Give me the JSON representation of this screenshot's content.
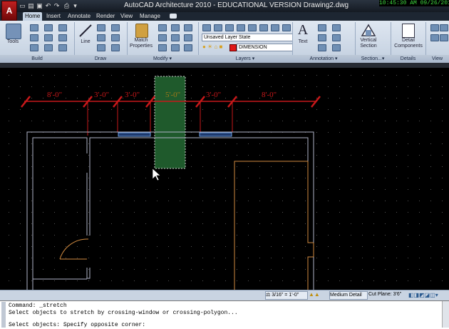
{
  "app": {
    "title": "AutoCAD Architecture 2010 - EDUCATIONAL VERSION    Drawing2.dwg",
    "clock": "10:45:30 AM 09/26/201"
  },
  "tabs": [
    "Home",
    "Insert",
    "Annotate",
    "Render",
    "View",
    "Manage"
  ],
  "ribbon": {
    "tools": "Tools",
    "line": "Line",
    "match": "Match Properties",
    "layer_state": "Unsaved Layer State",
    "layer_name": "DIMENSION",
    "text": "Text",
    "vertical_section": "Vertical Section",
    "detail_components": "Detail Components",
    "view": "View",
    "panels": [
      "Build",
      "Draw",
      "Modify ▾",
      "Layers ▾",
      "Annotation ▾",
      "Section...▾",
      "Details",
      "View"
    ]
  },
  "dimensions": [
    "8'-0\"",
    "3'-0\"",
    "3'-0\"",
    "5'-0\"",
    "3'-0\"",
    "8'-0\""
  ],
  "status": {
    "scale": "3/16\" = 1'-0\"",
    "detail": "Medium Detail",
    "cut_plane_label": "Cut Plane:",
    "cut_plane": "3'6\""
  },
  "command": {
    "line1": "Command: _stretch",
    "line2": "Select objects to stretch by crossing-window or crossing-polygon...",
    "line3": "Select objects: Specify opposite corner:"
  },
  "colors": {
    "dimension": "#c8181a",
    "selection": "#1f5a2c",
    "wall": "#b0b4c8",
    "door": "#d08a40"
  }
}
